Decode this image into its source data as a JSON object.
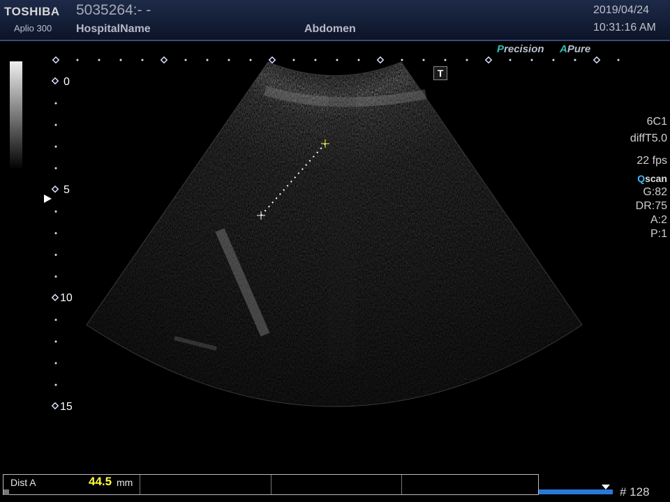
{
  "header": {
    "brand": "TOSHIBA",
    "model": "Aplio 300",
    "patient_id": "5035264:- -",
    "hospital": "HospitalName",
    "preset": "Abdomen",
    "date": "2019/04/24",
    "time": "10:31:16 AM"
  },
  "modes": {
    "precision_letter": "P",
    "precision_rest": "recision",
    "apure_letter": "A",
    "apure_rest": "Pure"
  },
  "params": {
    "probe": "6C1",
    "tissue": "diffT5.0",
    "fps": "22 fps",
    "qscan_q": "Q",
    "qscan_rest": "scan",
    "gain": "G:82",
    "dynamic_range": "DR:75",
    "a": "A:2",
    "p": "P:1"
  },
  "t_button": "T",
  "depth_scale": {
    "labels": [
      "0",
      "5",
      "10",
      "15"
    ]
  },
  "measurement": {
    "label": "Dist A",
    "value": "44.5",
    "unit": "mm"
  },
  "frame_counter": "# 128",
  "colors": {
    "header_bg": "#12203c",
    "mode_accent": "#2ec0b8",
    "qscan_accent": "#40b8ff",
    "measure_value": "#ffff40",
    "caliper": "#ffff40",
    "frame_bar": "#2a78d8"
  }
}
